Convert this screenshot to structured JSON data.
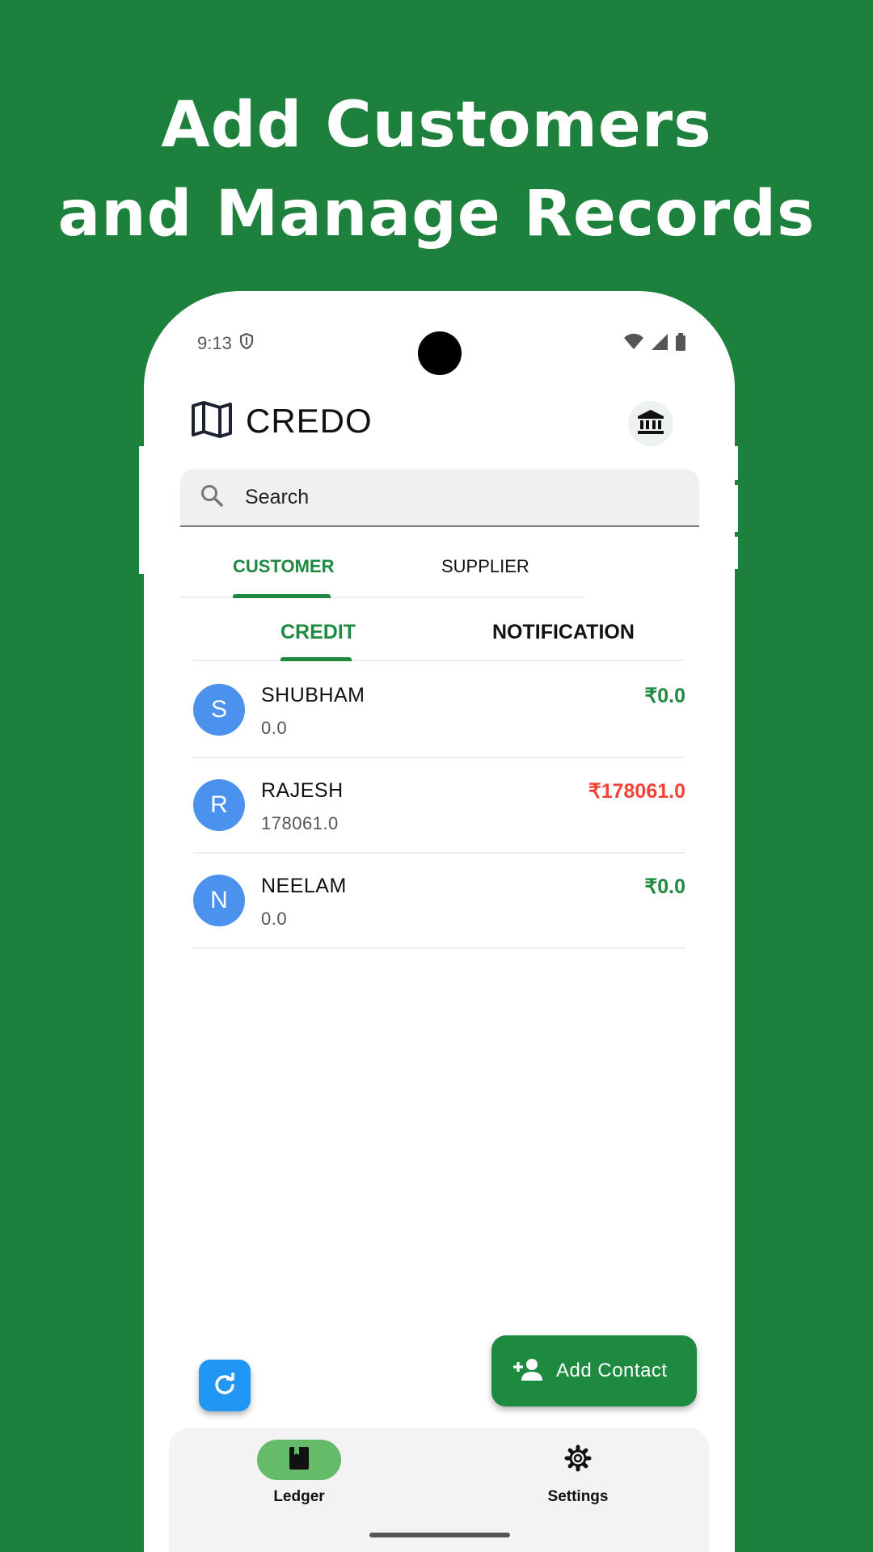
{
  "headline": {
    "line1": "Add Customers",
    "line2": "and Manage Records"
  },
  "status_bar": {
    "time": "9:13"
  },
  "app_bar": {
    "title": "CREDO"
  },
  "search": {
    "placeholder": "Search"
  },
  "top_tabs": [
    {
      "label": "CUSTOMER",
      "selected": true
    },
    {
      "label": "SUPPLIER",
      "selected": false
    }
  ],
  "sub_tabs": [
    {
      "label": "CREDIT",
      "selected": true
    },
    {
      "label": "NOTIFICATION",
      "selected": false
    }
  ],
  "contacts": [
    {
      "initial": "S",
      "name": "SHUBHAM",
      "balance": "0.0",
      "amount": "₹0.0",
      "amount_color": "#1e8a3f"
    },
    {
      "initial": "R",
      "name": "RAJESH",
      "balance": "178061.0",
      "amount": "₹178061.0",
      "amount_color": "#f44336"
    },
    {
      "initial": "N",
      "name": "NEELAM",
      "balance": "0.0",
      "amount": "₹0.0",
      "amount_color": "#1e8a3f"
    }
  ],
  "fab": {
    "label": "Add Contact"
  },
  "bottom_nav": [
    {
      "label": "Ledger",
      "icon": "book-icon",
      "selected": true
    },
    {
      "label": "Settings",
      "icon": "gear-icon",
      "selected": false
    }
  ],
  "colors": {
    "background": "#1e803d",
    "accent": "#1e8a3f",
    "avatar": "#4a92ee",
    "negative": "#f44336",
    "refresh_button": "#2196f3"
  }
}
